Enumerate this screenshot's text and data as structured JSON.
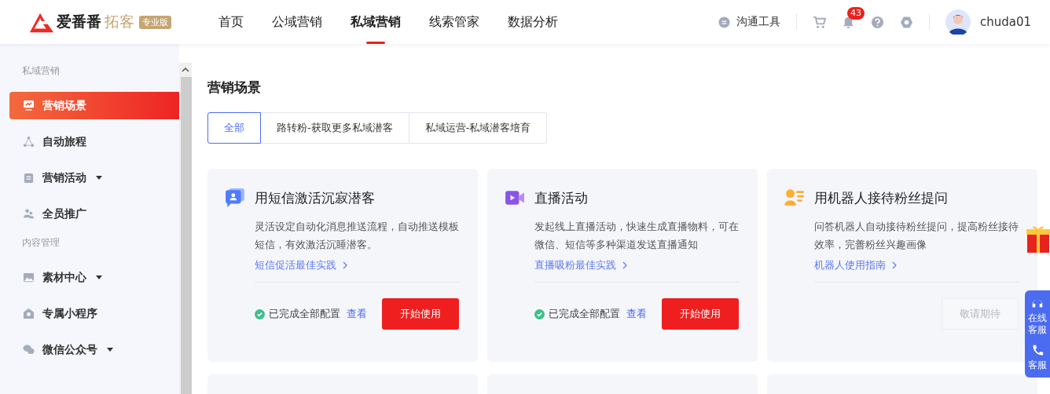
{
  "brand": {
    "name": "爱番番",
    "product": "拓客",
    "edition": "专业版"
  },
  "nav": [
    {
      "label": "首页",
      "selected": false
    },
    {
      "label": "公域营销",
      "selected": false
    },
    {
      "label": "私域营销",
      "selected": true
    },
    {
      "label": "线索管家",
      "selected": false
    },
    {
      "label": "数据分析",
      "selected": false
    }
  ],
  "header_tools": {
    "chat_label": "沟通工具",
    "notification_count": "43",
    "username": "chuda01"
  },
  "sidebar": [
    {
      "title": "私域营销",
      "items": [
        {
          "label": "营销场景",
          "selected": true,
          "has_menu": false
        },
        {
          "label": "自动旅程",
          "selected": false,
          "has_menu": false
        },
        {
          "label": "营销活动",
          "selected": false,
          "has_menu": true
        },
        {
          "label": "全员推广",
          "selected": false,
          "has_menu": false
        }
      ]
    },
    {
      "title": "内容管理",
      "items": [
        {
          "label": "素材中心",
          "selected": false,
          "has_menu": true
        },
        {
          "label": "专属小程序",
          "selected": false,
          "has_menu": false
        },
        {
          "label": "微信公众号",
          "selected": false,
          "has_menu": true
        }
      ]
    }
  ],
  "page_title": "营销场景",
  "filters": [
    {
      "label": "全部",
      "selected": true
    },
    {
      "label": "路转粉-获取更多私域潜客",
      "selected": false
    },
    {
      "label": "私域运营-私域潜客培育",
      "selected": false
    }
  ],
  "cards": [
    {
      "title": "用短信激活沉寂潜客",
      "description": "灵活设定自动化消息推送流程，自动推送模板短信，有效激活沉睡潜客。",
      "link": "短信促活最佳实践",
      "status": "已完成全部配置",
      "status_link": "查看",
      "button": "开始使用",
      "enabled": true
    },
    {
      "title": "直播活动",
      "description": "发起线上直播活动，快速生成直播物料，可在微信、短信等多种渠道发送直播通知",
      "link": "直播吸粉最佳实践",
      "status": "已完成全部配置",
      "status_link": "查看",
      "button": "开始使用",
      "enabled": true
    },
    {
      "title": "用机器人接待粉丝提问",
      "description": "问答机器人自动接待粉丝提问，提高粉丝接待效率，完善粉丝兴趣画像",
      "link": "机器人使用指南",
      "button": "敬请期待",
      "enabled": false
    }
  ],
  "float_panel": [
    {
      "label": "在线客服"
    },
    {
      "label": "客服"
    }
  ]
}
